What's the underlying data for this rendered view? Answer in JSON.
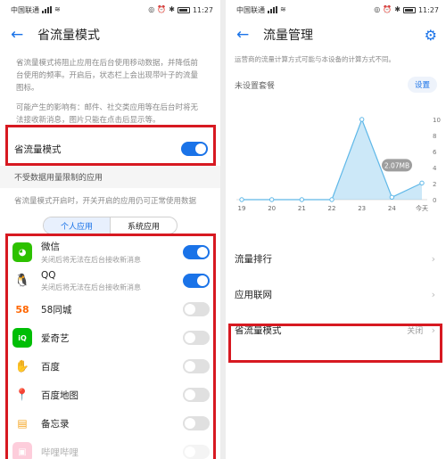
{
  "left": {
    "status": {
      "carrier": "中国联通",
      "time": "11:27"
    },
    "title": "省流量模式",
    "description": "省流量模式将阻止应用在后台使用移动数据，并降低前台使用的频率。开启后，状态栏上会出现带叶子的流量图标。",
    "impact": "可能产生的影响有：邮件、社交类应用等在后台时将无法接收新消息，图片只能在点击后显示等。",
    "mode_label": "省流量模式",
    "unrestricted_header": "不受数据用量限制的应用",
    "unrestricted_desc": "省流量模式开启时，开关开启的应用仍可正常使用数据",
    "tabs": [
      "个人应用",
      "系统应用"
    ],
    "apps": [
      {
        "name": "微信",
        "sub": "关闭后将无法在后台接收新消息",
        "on": true,
        "icon": "wechat-icon"
      },
      {
        "name": "QQ",
        "sub": "关闭后将无法在后台接收新消息",
        "on": true,
        "icon": "qq-icon"
      },
      {
        "name": "58同城",
        "sub": "",
        "on": false,
        "icon": "58-icon"
      },
      {
        "name": "爱奇艺",
        "sub": "",
        "on": false,
        "icon": "iqiyi-icon"
      },
      {
        "name": "百度",
        "sub": "",
        "on": false,
        "icon": "baidu-icon"
      },
      {
        "name": "百度地图",
        "sub": "",
        "on": false,
        "icon": "baidu-map-icon"
      },
      {
        "name": "备忘录",
        "sub": "",
        "on": false,
        "icon": "notes-icon"
      },
      {
        "name": "哔哩哔哩",
        "sub": "",
        "on": false,
        "icon": "bilibili-icon"
      }
    ]
  },
  "right": {
    "status": {
      "carrier": "中国联通",
      "time": "11:27"
    },
    "title": "流量管理",
    "note": "运营商的流量计算方式可能与本设备的计算方式不同。",
    "plan_label": "未设置套餐",
    "settings_button": "设置",
    "menu": [
      {
        "label": "流量排行",
        "value": ""
      },
      {
        "label": "应用联网",
        "value": ""
      },
      {
        "label": "省流量模式",
        "value": "关闭"
      }
    ]
  },
  "chart_data": {
    "type": "area",
    "categories": [
      "19",
      "20",
      "21",
      "22",
      "23",
      "24",
      "今天"
    ],
    "values": [
      0,
      0,
      0,
      0,
      10,
      0.3,
      2.07
    ],
    "yticks": [
      0,
      2,
      4,
      6,
      8,
      10
    ],
    "ylim": [
      0,
      10
    ],
    "annotation": "2.07MB",
    "annotation_index": 6,
    "color": "#8ecdf0"
  }
}
